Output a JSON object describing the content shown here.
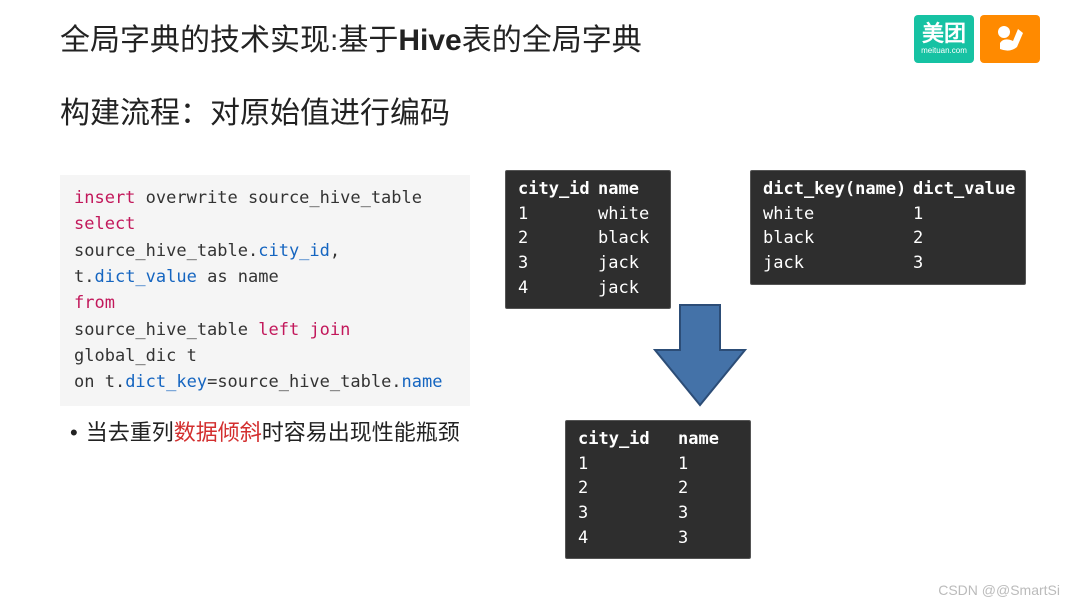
{
  "header": {
    "title_pre": "全局字典的技术实现:基于",
    "title_hive": "Hive",
    "title_post": "表的全局字典",
    "logo_text": "美团",
    "logo_sub": "meituan.com"
  },
  "subtitle": "构建流程：对原始值进行编码",
  "code": {
    "l1a": "insert",
    "l1b": " overwrite source_hive_table",
    "l2": "select",
    "l3a": "source_hive_table.",
    "l3b": "city_id",
    "l3c": ",",
    "l4a": "t.",
    "l4b": "dict_value",
    "l4c": " as name",
    "l5": "from",
    "l6a": "source_hive_table ",
    "l6b": "left",
    "l6c": " ",
    "l6d": "join",
    "l6e": " global_dic t",
    "l7a": "on t.",
    "l7b": "dict_key",
    "l7c": "=source_hive_table.",
    "l7d": "name"
  },
  "bullet": {
    "dot": "•",
    "t1": "当去重列",
    "red": "数据倾斜",
    "t2": "时容易出现性能瓶颈"
  },
  "table1": {
    "h1": "city_id",
    "h2": "name",
    "rows": [
      {
        "c1": "1",
        "c2": "white"
      },
      {
        "c1": "2",
        "c2": "black"
      },
      {
        "c1": "3",
        "c2": "jack"
      },
      {
        "c1": "4",
        "c2": "jack"
      }
    ]
  },
  "table2": {
    "h1": "dict_key(name)",
    "h2": "dict_value",
    "rows": [
      {
        "c1": "white",
        "c2": "1"
      },
      {
        "c1": "black",
        "c2": "2"
      },
      {
        "c1": "jack",
        "c2": "3"
      }
    ]
  },
  "table3": {
    "h1": "city_id",
    "h2": "name",
    "rows": [
      {
        "c1": "1",
        "c2": "1"
      },
      {
        "c1": "2",
        "c2": "2"
      },
      {
        "c1": "3",
        "c2": "3"
      },
      {
        "c1": "4",
        "c2": "3"
      }
    ]
  },
  "watermark": "CSDN @@SmartSi"
}
